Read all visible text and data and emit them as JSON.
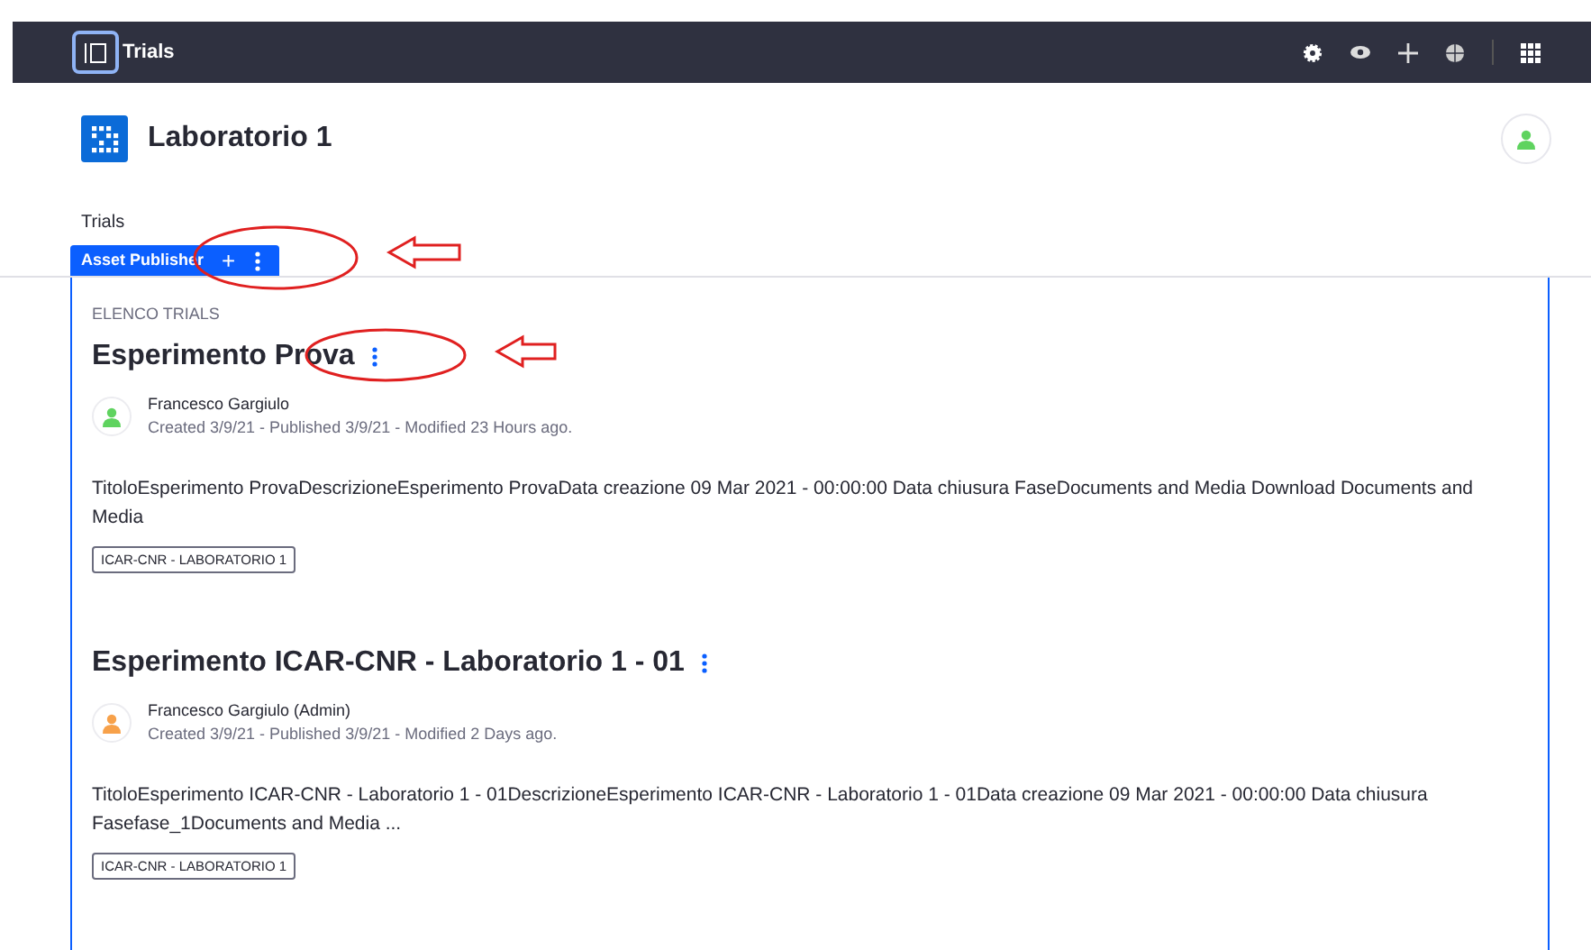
{
  "topbar": {
    "title": "Trials"
  },
  "site": {
    "title": "Laboratorio 1"
  },
  "breadcrumb": "Trials",
  "portlet": {
    "tab": "Asset Publisher",
    "add": "+",
    "heading": "ELENCO TRIALS"
  },
  "entries": [
    {
      "title": "Esperimento Prova",
      "author": "Francesco Gargiulo",
      "color": "#5fd35f",
      "meta": "Created 3/9/21 - Published 3/9/21 - Modified 23 Hours ago.",
      "summary": "TitoloEsperimento ProvaDescrizioneEsperimento ProvaData creazione 09 Mar 2021 - 00:00:00 Data chiusura FaseDocuments and Media Download Documents and Media",
      "tag": "ICAR-CNR - LABORATORIO 1"
    },
    {
      "title": "Esperimento ICAR-CNR - Laboratorio 1 - 01",
      "author": "Francesco Gargiulo (Admin)",
      "color": "#f7a14a",
      "meta": "Created 3/9/21 - Published 3/9/21 - Modified 2 Days ago.",
      "summary": "TitoloEsperimento ICAR-CNR - Laboratorio 1 - 01DescrizioneEsperimento ICAR-CNR - Laboratorio 1 - 01Data creazione 09 Mar 2021 - 00:00:00 Data chiusura Fasefase_1Documents and Media ...",
      "tag": "ICAR-CNR - LABORATORIO 1"
    }
  ]
}
